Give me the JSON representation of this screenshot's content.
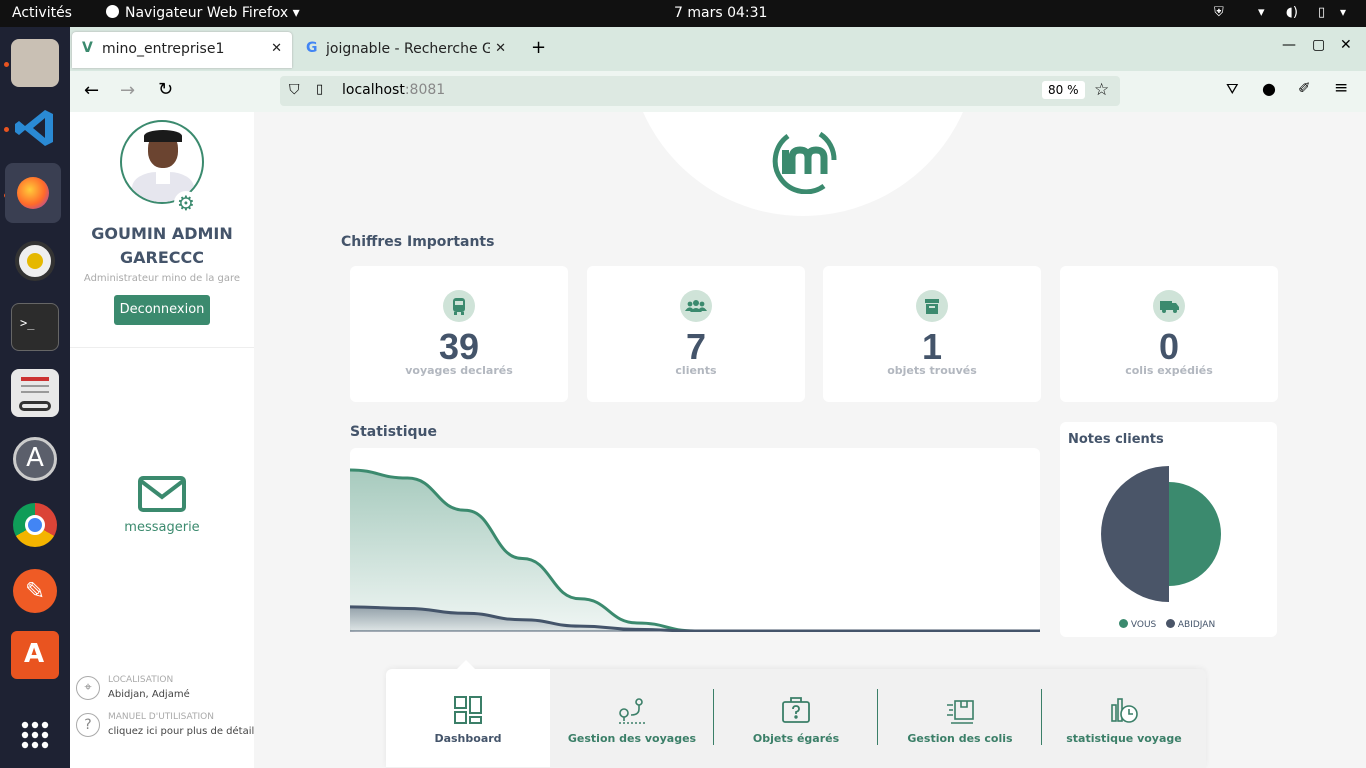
{
  "os": {
    "activities": "Activités",
    "app_menu": "Navigateur Web Firefox",
    "clock": "7 mars  04:31"
  },
  "browser": {
    "tabs": [
      {
        "label": "mino_entreprise1"
      },
      {
        "label": "joignable - Recherche Go"
      }
    ],
    "url_host": "localhost",
    "url_port": ":8081",
    "zoom": "80 %"
  },
  "sidebar": {
    "user_name": "GOUMIN ADMIN GARECCC",
    "role": "Administrateur mino de la gare",
    "logout": "Deconnexion",
    "messaging": "messagerie",
    "location_title": "LOCALISATION",
    "location_value": "Abidjan, Adjamé",
    "manual_title": "MANUEL D'UTILISATION",
    "manual_value": "cliquez ici pour plus de détails"
  },
  "main": {
    "section_title": "Chiffres Importants",
    "stats": [
      {
        "value": "39",
        "label": "voyages declarés",
        "icon": "bus-icon"
      },
      {
        "value": "7",
        "label": "clients",
        "icon": "users-icon"
      },
      {
        "value": "1",
        "label": "objets trouvés",
        "icon": "archive-icon"
      },
      {
        "value": "0",
        "label": "colis expédiés",
        "icon": "truck-icon"
      }
    ],
    "stat_title": "Statistique",
    "notes_title": "Notes clients"
  },
  "chart_data": [
    {
      "type": "area",
      "title": "Statistique",
      "series": [
        {
          "values": [
            1,
            0.95,
            0.75,
            0.45,
            0.2,
            0.05,
            0,
            0,
            0,
            0,
            0,
            0,
            0
          ],
          "color": "#3b8a6e"
        },
        {
          "values": [
            0.15,
            0.14,
            0.11,
            0.07,
            0.03,
            0.01,
            0,
            0,
            0,
            0,
            0,
            0,
            0
          ],
          "color": "#44546a"
        }
      ]
    },
    {
      "type": "pie",
      "title": "Notes clients",
      "legend": [
        "VOUS",
        "ABIDJAN"
      ],
      "values": [
        50,
        50
      ],
      "colors": [
        "#3b8a6e",
        "#4a5568"
      ]
    }
  ],
  "bottom_nav": [
    {
      "label": "Dashboard"
    },
    {
      "label": "Gestion des voyages"
    },
    {
      "label": "Objets égarés"
    },
    {
      "label": "Gestion des colis"
    },
    {
      "label": "statistique voyage"
    }
  ],
  "colors": {
    "accent": "#3b8a6e",
    "dark": "#44546a"
  }
}
